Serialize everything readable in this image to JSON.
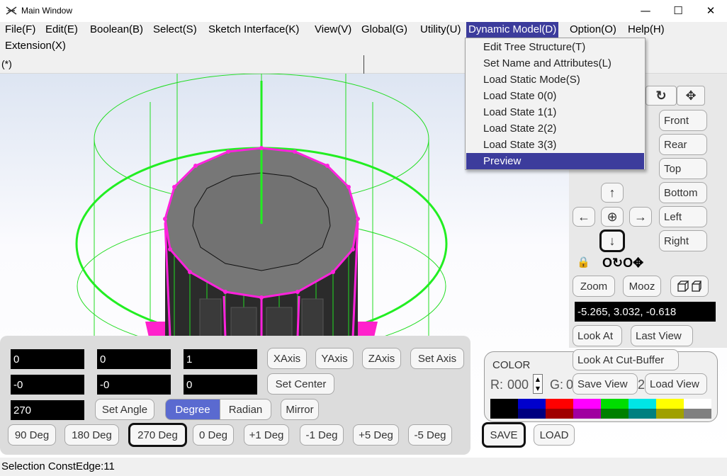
{
  "window": {
    "title": "Main Window",
    "minimize": "—",
    "maximize": "☐",
    "close": "✕"
  },
  "menu": [
    "File(F)",
    "Edit(E)",
    "Boolean(B)",
    "Select(S)",
    "Sketch Interface(K)",
    "View(V)",
    "Global(G)",
    "Utility(U)",
    "Dynamic Model(D)",
    "Option(O)",
    "Help(H)",
    "Extension(X)"
  ],
  "doc_tab": "(*)",
  "dropdown": [
    "Edit Tree Structure(T)",
    "Set Name and Attributes(L)",
    "Load Static Mode(S)",
    "Load State 0(0)",
    "Load State 1(1)",
    "Load State 2(2)",
    "Load State 3(3)",
    "Preview"
  ],
  "view_buttons": {
    "front": "Front",
    "rear": "Rear",
    "top": "Top",
    "bottom": "Bottom",
    "left": "Left",
    "right": "Right"
  },
  "nav": {
    "up": "↑",
    "down": "↓",
    "left": "←",
    "right": "→",
    "center": "⊕",
    "rotate": "↻",
    "move": "✥",
    "lock": "🔒",
    "mode_icons": "O↻O✥"
  },
  "zoom": {
    "zoom": "Zoom",
    "mooz": "Mooz"
  },
  "coords": "-5.265, 3.032, -0.618",
  "look_buttons": {
    "look_at": "Look At",
    "last_view": "Last View",
    "look_at_cut": "Look At Cut-Buffer",
    "save_view": "Save View",
    "load_view": "Load View"
  },
  "color": {
    "label": "COLOR",
    "r_label": "R:",
    "r_value": "000",
    "g_label": "G:",
    "g_value": "0",
    "b_partial": "2",
    "swatches_top": [
      "#000000",
      "#0000cc",
      "#ff0000",
      "#ff00ff",
      "#00dd00",
      "#00e6e6",
      "#ffff00",
      "#ffffff"
    ],
    "swatches_bottom": [
      "#000000",
      "#000080",
      "#a00000",
      "#a000a0",
      "#008000",
      "#008080",
      "#a0a000",
      "#808080"
    ]
  },
  "file_buttons": {
    "save": "SAVE",
    "load": "LOAD"
  },
  "axis": {
    "row1": [
      "0",
      "0",
      "1"
    ],
    "row2": [
      "-0",
      "-0",
      "0"
    ],
    "angle": "270",
    "xaxis": "XAxis",
    "yaxis": "YAxis",
    "zaxis": "ZAxis",
    "set_axis": "Set Axis",
    "set_center": "Set Center",
    "set_angle": "Set Angle",
    "degree": "Degree",
    "radian": "Radian",
    "mirror": "Mirror",
    "deg_buttons": [
      "90 Deg",
      "180 Deg",
      "270 Deg",
      "0 Deg",
      "+1 Deg",
      "-1 Deg",
      "+5 Deg",
      "-5 Deg"
    ]
  },
  "status": "Selection  ConstEdge:11"
}
